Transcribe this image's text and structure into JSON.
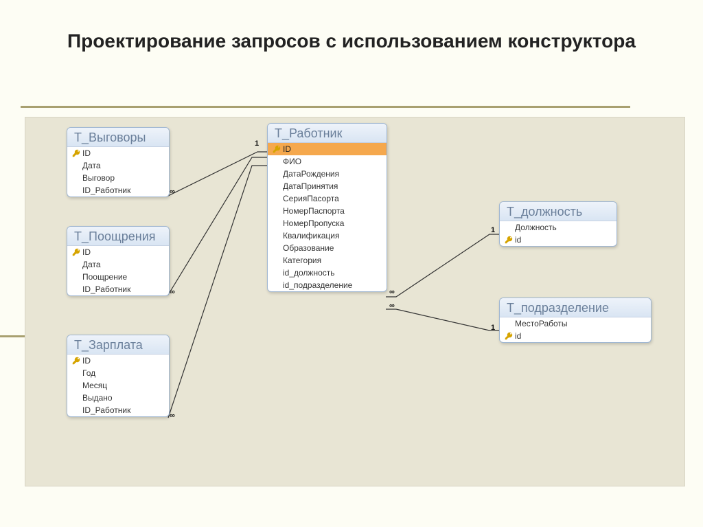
{
  "title": "Проектирование запросов с использованием конструктора",
  "tables": {
    "reprimands": {
      "title": "Т_Выговоры",
      "fields": [
        "ID",
        "Дата",
        "Выговор",
        "ID_Работник"
      ]
    },
    "rewards": {
      "title": "Т_Поощрения",
      "fields": [
        "ID",
        "Дата",
        "Поощрение",
        "ID_Работник"
      ]
    },
    "salary": {
      "title": "Т_Зарплата",
      "fields": [
        "ID",
        "Год",
        "Месяц",
        "Выдано",
        "ID_Работник"
      ]
    },
    "employee": {
      "title": "Т_Работник",
      "fields": [
        "ID",
        "ФИО",
        "ДатаРождения",
        "ДатаПринятия",
        "СерияПасорта",
        "НомерПаспорта",
        "НомерПропуска",
        "Квалификация",
        "Образование",
        "Категория",
        "id_должность",
        "id_подразделение"
      ]
    },
    "position": {
      "title": "Т_должность",
      "fields": [
        "Должность",
        "id"
      ]
    },
    "department": {
      "title": "Т_подразделение",
      "fields": [
        "МестоРаботы",
        "id"
      ]
    }
  },
  "labels": {
    "one": "1",
    "inf": "∞"
  }
}
